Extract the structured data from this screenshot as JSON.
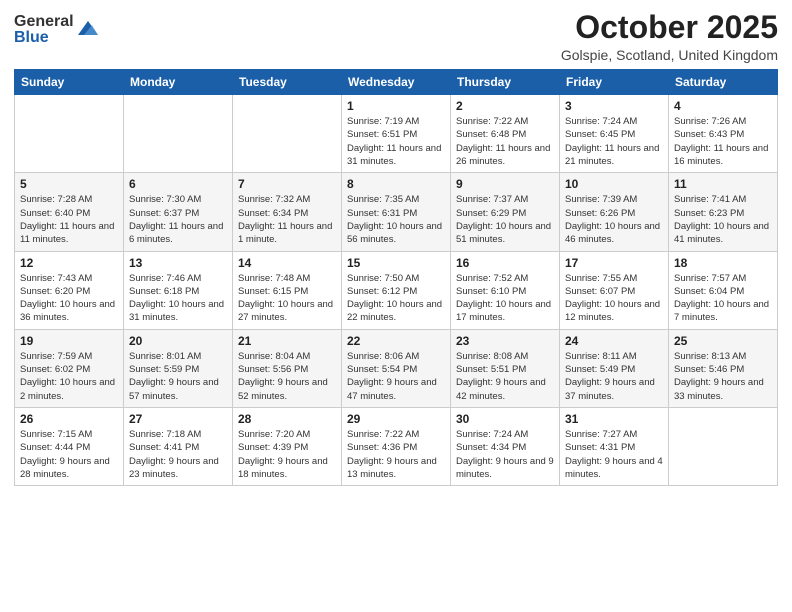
{
  "logo": {
    "general": "General",
    "blue": "Blue"
  },
  "title": "October 2025",
  "location": "Golspie, Scotland, United Kingdom",
  "days_of_week": [
    "Sunday",
    "Monday",
    "Tuesday",
    "Wednesday",
    "Thursday",
    "Friday",
    "Saturday"
  ],
  "weeks": [
    [
      {
        "day": "",
        "info": ""
      },
      {
        "day": "",
        "info": ""
      },
      {
        "day": "",
        "info": ""
      },
      {
        "day": "1",
        "info": "Sunrise: 7:19 AM\nSunset: 6:51 PM\nDaylight: 11 hours\nand 31 minutes."
      },
      {
        "day": "2",
        "info": "Sunrise: 7:22 AM\nSunset: 6:48 PM\nDaylight: 11 hours\nand 26 minutes."
      },
      {
        "day": "3",
        "info": "Sunrise: 7:24 AM\nSunset: 6:45 PM\nDaylight: 11 hours\nand 21 minutes."
      },
      {
        "day": "4",
        "info": "Sunrise: 7:26 AM\nSunset: 6:43 PM\nDaylight: 11 hours\nand 16 minutes."
      }
    ],
    [
      {
        "day": "5",
        "info": "Sunrise: 7:28 AM\nSunset: 6:40 PM\nDaylight: 11 hours\nand 11 minutes."
      },
      {
        "day": "6",
        "info": "Sunrise: 7:30 AM\nSunset: 6:37 PM\nDaylight: 11 hours\nand 6 minutes."
      },
      {
        "day": "7",
        "info": "Sunrise: 7:32 AM\nSunset: 6:34 PM\nDaylight: 11 hours\nand 1 minute."
      },
      {
        "day": "8",
        "info": "Sunrise: 7:35 AM\nSunset: 6:31 PM\nDaylight: 10 hours\nand 56 minutes."
      },
      {
        "day": "9",
        "info": "Sunrise: 7:37 AM\nSunset: 6:29 PM\nDaylight: 10 hours\nand 51 minutes."
      },
      {
        "day": "10",
        "info": "Sunrise: 7:39 AM\nSunset: 6:26 PM\nDaylight: 10 hours\nand 46 minutes."
      },
      {
        "day": "11",
        "info": "Sunrise: 7:41 AM\nSunset: 6:23 PM\nDaylight: 10 hours\nand 41 minutes."
      }
    ],
    [
      {
        "day": "12",
        "info": "Sunrise: 7:43 AM\nSunset: 6:20 PM\nDaylight: 10 hours\nand 36 minutes."
      },
      {
        "day": "13",
        "info": "Sunrise: 7:46 AM\nSunset: 6:18 PM\nDaylight: 10 hours\nand 31 minutes."
      },
      {
        "day": "14",
        "info": "Sunrise: 7:48 AM\nSunset: 6:15 PM\nDaylight: 10 hours\nand 27 minutes."
      },
      {
        "day": "15",
        "info": "Sunrise: 7:50 AM\nSunset: 6:12 PM\nDaylight: 10 hours\nand 22 minutes."
      },
      {
        "day": "16",
        "info": "Sunrise: 7:52 AM\nSunset: 6:10 PM\nDaylight: 10 hours\nand 17 minutes."
      },
      {
        "day": "17",
        "info": "Sunrise: 7:55 AM\nSunset: 6:07 PM\nDaylight: 10 hours\nand 12 minutes."
      },
      {
        "day": "18",
        "info": "Sunrise: 7:57 AM\nSunset: 6:04 PM\nDaylight: 10 hours\nand 7 minutes."
      }
    ],
    [
      {
        "day": "19",
        "info": "Sunrise: 7:59 AM\nSunset: 6:02 PM\nDaylight: 10 hours\nand 2 minutes."
      },
      {
        "day": "20",
        "info": "Sunrise: 8:01 AM\nSunset: 5:59 PM\nDaylight: 9 hours\nand 57 minutes."
      },
      {
        "day": "21",
        "info": "Sunrise: 8:04 AM\nSunset: 5:56 PM\nDaylight: 9 hours\nand 52 minutes."
      },
      {
        "day": "22",
        "info": "Sunrise: 8:06 AM\nSunset: 5:54 PM\nDaylight: 9 hours\nand 47 minutes."
      },
      {
        "day": "23",
        "info": "Sunrise: 8:08 AM\nSunset: 5:51 PM\nDaylight: 9 hours\nand 42 minutes."
      },
      {
        "day": "24",
        "info": "Sunrise: 8:11 AM\nSunset: 5:49 PM\nDaylight: 9 hours\nand 37 minutes."
      },
      {
        "day": "25",
        "info": "Sunrise: 8:13 AM\nSunset: 5:46 PM\nDaylight: 9 hours\nand 33 minutes."
      }
    ],
    [
      {
        "day": "26",
        "info": "Sunrise: 7:15 AM\nSunset: 4:44 PM\nDaylight: 9 hours\nand 28 minutes."
      },
      {
        "day": "27",
        "info": "Sunrise: 7:18 AM\nSunset: 4:41 PM\nDaylight: 9 hours\nand 23 minutes."
      },
      {
        "day": "28",
        "info": "Sunrise: 7:20 AM\nSunset: 4:39 PM\nDaylight: 9 hours\nand 18 minutes."
      },
      {
        "day": "29",
        "info": "Sunrise: 7:22 AM\nSunset: 4:36 PM\nDaylight: 9 hours\nand 13 minutes."
      },
      {
        "day": "30",
        "info": "Sunrise: 7:24 AM\nSunset: 4:34 PM\nDaylight: 9 hours\nand 9 minutes."
      },
      {
        "day": "31",
        "info": "Sunrise: 7:27 AM\nSunset: 4:31 PM\nDaylight: 9 hours\nand 4 minutes."
      },
      {
        "day": "",
        "info": ""
      }
    ]
  ]
}
